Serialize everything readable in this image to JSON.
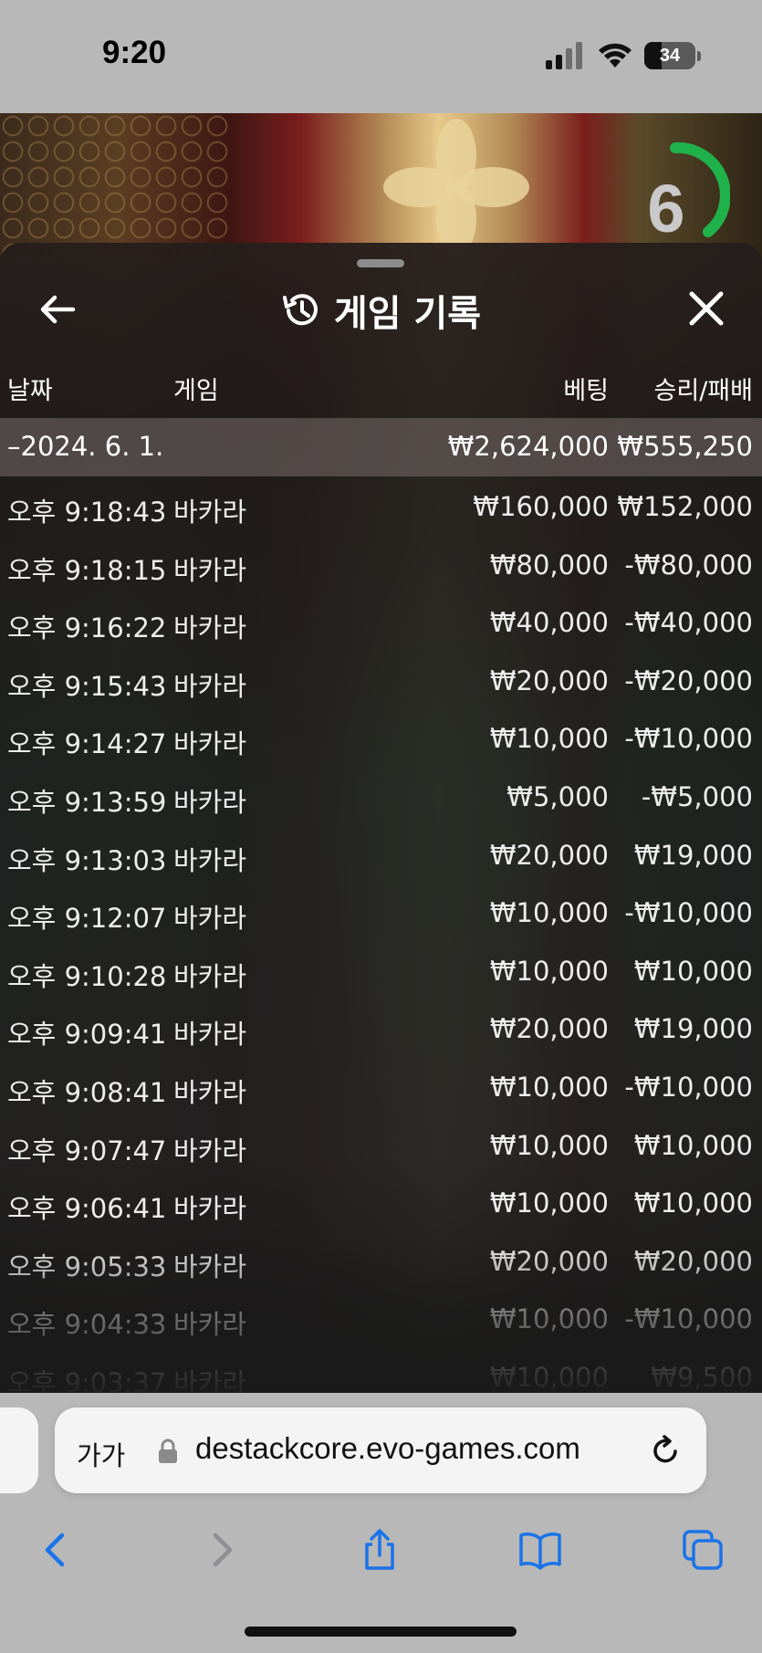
{
  "status_bar": {
    "time": "9:20",
    "battery": "34"
  },
  "video": {
    "timer": "6",
    "accent_color": "#1fb24a"
  },
  "sheet": {
    "title": "게임 기록",
    "columns": {
      "date": "날짜",
      "game": "게임",
      "bet": "베팅",
      "result": "승리/패배"
    },
    "day": {
      "label": "–2024. 6. 1.",
      "bet_total": "₩2,624,000",
      "result_total": "₩555,250"
    },
    "rows": [
      {
        "time": "오후 9:18:43",
        "game": "바카라",
        "bet": "₩160,000",
        "result": "₩152,000"
      },
      {
        "time": "오후 9:18:15",
        "game": "바카라",
        "bet": "₩80,000",
        "result": "-₩80,000"
      },
      {
        "time": "오후 9:16:22",
        "game": "바카라",
        "bet": "₩40,000",
        "result": "-₩40,000"
      },
      {
        "time": "오후 9:15:43",
        "game": "바카라",
        "bet": "₩20,000",
        "result": "-₩20,000"
      },
      {
        "time": "오후 9:14:27",
        "game": "바카라",
        "bet": "₩10,000",
        "result": "-₩10,000"
      },
      {
        "time": "오후 9:13:59",
        "game": "바카라",
        "bet": "₩5,000",
        "result": "-₩5,000"
      },
      {
        "time": "오후 9:13:03",
        "game": "바카라",
        "bet": "₩20,000",
        "result": "₩19,000"
      },
      {
        "time": "오후 9:12:07",
        "game": "바카라",
        "bet": "₩10,000",
        "result": "-₩10,000"
      },
      {
        "time": "오후 9:10:28",
        "game": "바카라",
        "bet": "₩10,000",
        "result": "₩10,000"
      },
      {
        "time": "오후 9:09:41",
        "game": "바카라",
        "bet": "₩20,000",
        "result": "₩19,000"
      },
      {
        "time": "오후 9:08:41",
        "game": "바카라",
        "bet": "₩10,000",
        "result": "-₩10,000"
      },
      {
        "time": "오후 9:07:47",
        "game": "바카라",
        "bet": "₩10,000",
        "result": "₩10,000"
      },
      {
        "time": "오후 9:06:41",
        "game": "바카라",
        "bet": "₩10,000",
        "result": "₩10,000"
      },
      {
        "time": "오후 9:05:33",
        "game": "바카라",
        "bet": "₩20,000",
        "result": "₩20,000"
      },
      {
        "time": "오후 9:04:33",
        "game": "바카라",
        "bet": "₩10,000",
        "result": "-₩10,000"
      },
      {
        "time": "오후 9:03:37",
        "game": "바카라",
        "bet": "₩10,000",
        "result": "₩9,500"
      }
    ]
  },
  "browser": {
    "aa_label": "가가",
    "url": "destackcore.evo-games.com",
    "toolbar": [
      "back-icon",
      "forward-icon",
      "share-icon",
      "bookmarks-icon",
      "tabs-icon"
    ],
    "accent_color": "#1a73e8"
  }
}
